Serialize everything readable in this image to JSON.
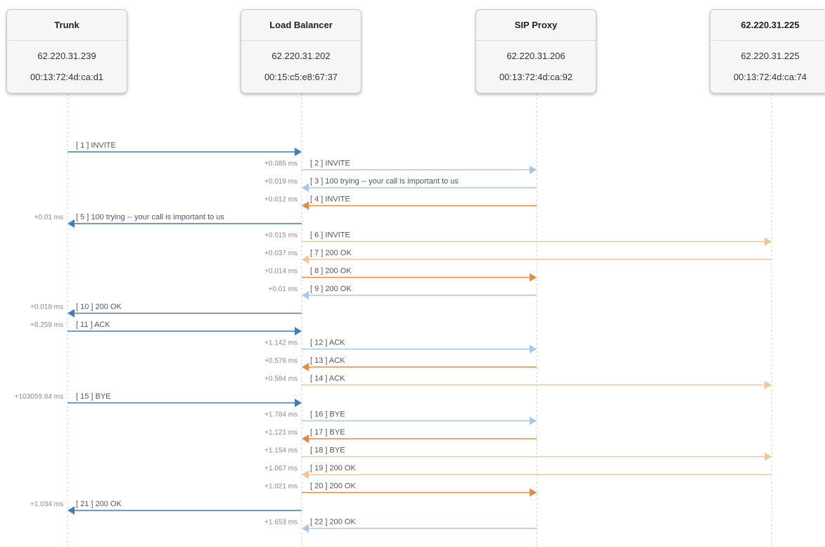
{
  "colors": {
    "blue_dark": "#3d7fc1",
    "blue_light": "#a9c6ea",
    "orange_dark": "#e8893b",
    "orange_light": "#f5c590",
    "lifeline": "#d0d0d0"
  },
  "nodes": [
    {
      "name": "Trunk",
      "ip": "62.220.31.239",
      "mac": "00:13:72:4d:ca:d1"
    },
    {
      "name": "Load Balancer",
      "ip": "62.220.31.202",
      "mac": "00:15:c5:e8:67:37"
    },
    {
      "name": "SIP Proxy",
      "ip": "62.220.31.206",
      "mac": "00:13:72:4d:ca:92"
    },
    {
      "name": "62.220.31.225",
      "ip": "62.220.31.225",
      "mac": "00:13:72:4d:ca:74"
    }
  ],
  "messages": [
    {
      "label": "[ 1 ] INVITE",
      "delta": "",
      "from": 0,
      "to": 1,
      "color": "blue_dark"
    },
    {
      "label": "[ 2 ] INVITE",
      "delta": "+0.085 ms",
      "from": 1,
      "to": 2,
      "color": "blue_light"
    },
    {
      "label": "[ 3 ] 100 trying -- your call is important to us",
      "delta": "+0.019 ms",
      "from": 2,
      "to": 1,
      "color": "blue_light"
    },
    {
      "label": "[ 4 ] INVITE",
      "delta": "+0.012 ms",
      "from": 2,
      "to": 1,
      "color": "orange_dark"
    },
    {
      "label": "[ 5 ] 100 trying -- your call is important to us",
      "delta": "+0.01 ms",
      "from": 1,
      "to": 0,
      "color": "blue_dark"
    },
    {
      "label": "[ 6 ] INVITE",
      "delta": "+0.015 ms",
      "from": 1,
      "to": 3,
      "color": "orange_light"
    },
    {
      "label": "[ 7 ] 200 OK",
      "delta": "+0.037 ms",
      "from": 3,
      "to": 1,
      "color": "orange_light"
    },
    {
      "label": "[ 8 ] 200 OK",
      "delta": "+0.014 ms",
      "from": 1,
      "to": 2,
      "color": "orange_dark"
    },
    {
      "label": "[ 9 ] 200 OK",
      "delta": "+0.01 ms",
      "from": 2,
      "to": 1,
      "color": "blue_light"
    },
    {
      "label": "[ 10 ] 200 OK",
      "delta": "+0.018 ms",
      "from": 1,
      "to": 0,
      "color": "blue_dark"
    },
    {
      "label": "[ 11 ] ACK",
      "delta": "+8.259 ms",
      "from": 0,
      "to": 1,
      "color": "blue_dark"
    },
    {
      "label": "[ 12 ] ACK",
      "delta": "+1.142 ms",
      "from": 1,
      "to": 2,
      "color": "blue_light"
    },
    {
      "label": "[ 13 ] ACK",
      "delta": "+0.576 ms",
      "from": 2,
      "to": 1,
      "color": "orange_dark"
    },
    {
      "label": "[ 14 ] ACK",
      "delta": "+0.584 ms",
      "from": 1,
      "to": 3,
      "color": "orange_light"
    },
    {
      "label": "[ 15 ] BYE",
      "delta": "+103059.84 ms",
      "from": 0,
      "to": 1,
      "color": "blue_dark"
    },
    {
      "label": "[ 16 ] BYE",
      "delta": "+1.784 ms",
      "from": 1,
      "to": 2,
      "color": "blue_light"
    },
    {
      "label": "[ 17 ] BYE",
      "delta": "+1.121 ms",
      "from": 2,
      "to": 1,
      "color": "orange_dark"
    },
    {
      "label": "[ 18 ] BYE",
      "delta": "+1.154 ms",
      "from": 1,
      "to": 3,
      "color": "orange_light"
    },
    {
      "label": "[ 19 ] 200 OK",
      "delta": "+1.067 ms",
      "from": 3,
      "to": 1,
      "color": "orange_light"
    },
    {
      "label": "[ 20 ] 200 OK",
      "delta": "+1.021 ms",
      "from": 1,
      "to": 2,
      "color": "orange_dark"
    },
    {
      "label": "[ 21 ] 200 OK",
      "delta": "+1.034 ms",
      "from": 1,
      "to": 0,
      "color": "blue_dark"
    },
    {
      "label": "[ 22 ] 200 OK",
      "delta": "+1.653 ms",
      "from": 2,
      "to": 1,
      "color": "blue_light"
    }
  ]
}
